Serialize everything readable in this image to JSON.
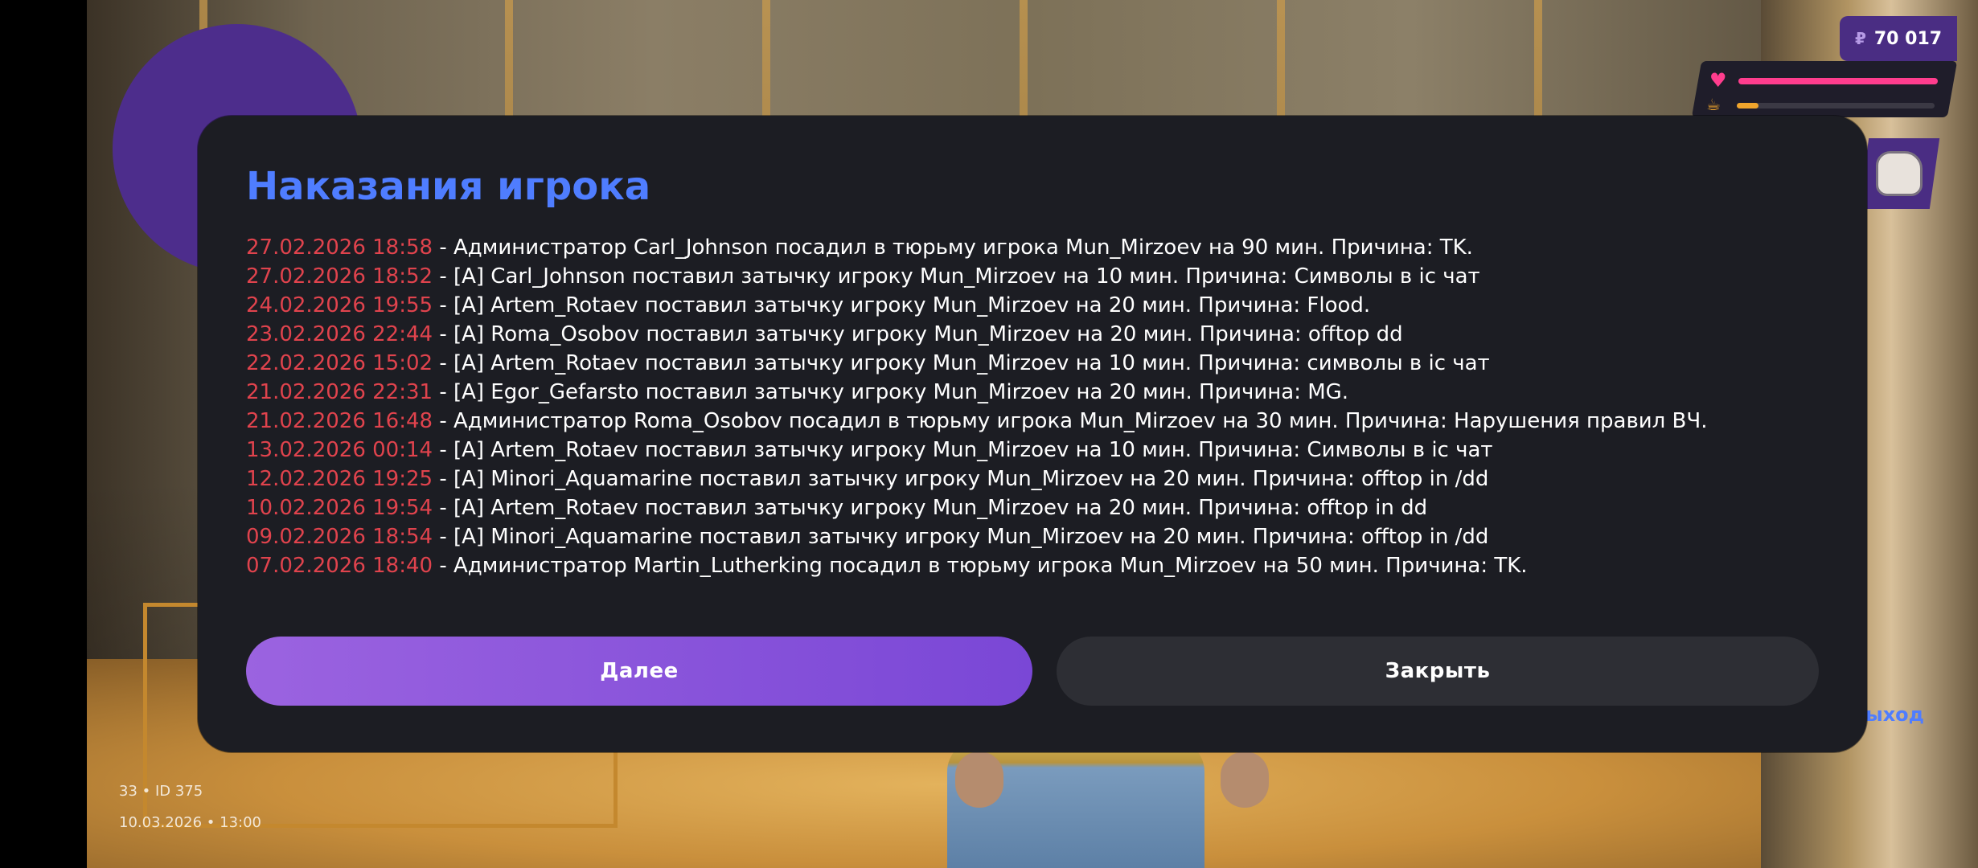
{
  "hud": {
    "money_currency": "₽",
    "money": "70 017",
    "health_fraction": 1.0,
    "hunger_fraction": 0.11,
    "exit_label": "ыход",
    "player_id_line": "33 • ID 375",
    "datetime_line": "10.03.2026 • 13:00"
  },
  "dialog": {
    "title": "Наказания игрока",
    "entries": [
      {
        "date": "27.02.2026 18:58",
        "text": " - Администратор Carl_Johnson посадил в тюрьму игрока Mun_Mirzoev на 90 мин. Причина: TK."
      },
      {
        "date": "27.02.2026 18:52",
        "text": " - [A] Carl_Johnson поставил затычку игроку Mun_Mirzoev на 10 мин. Причина: Символы в ic чат"
      },
      {
        "date": "24.02.2026 19:55",
        "text": " - [A] Artem_Rotaev поставил затычку игроку Mun_Mirzoev на 20 мин. Причина: Flood."
      },
      {
        "date": "23.02.2026 22:44",
        "text": " - [A] Roma_Osobov поставил затычку игроку Mun_Mirzoev на 20 мин. Причина: offtop dd"
      },
      {
        "date": "22.02.2026 15:02",
        "text": " - [A] Artem_Rotaev поставил затычку игроку Mun_Mirzoev на 10 мин. Причина: символы в ic чат"
      },
      {
        "date": "21.02.2026 22:31",
        "text": " - [A] Egor_Gefarsto поставил затычку игроку Mun_Mirzoev на 20 мин. Причина: MG."
      },
      {
        "date": "21.02.2026 16:48",
        "text": " - Администратор Roma_Osobov посадил в тюрьму игрока Mun_Mirzoev на 30 мин. Причина: Нарушения правил ВЧ."
      },
      {
        "date": "13.02.2026 00:14",
        "text": " - [A] Artem_Rotaev поставил затычку игроку Mun_Mirzoev на 10 мин. Причина: Символы в ic чат"
      },
      {
        "date": "12.02.2026 19:25",
        "text": " - [A] Minori_Aquamarine поставил затычку игроку Mun_Mirzoev на 20 мин. Причина: offtop in /dd"
      },
      {
        "date": "10.02.2026 19:54",
        "text": " - [A] Artem_Rotaev поставил затычку игроку Mun_Mirzoev на 20 мин. Причина: offtop in dd"
      },
      {
        "date": "09.02.2026 18:54",
        "text": " - [A] Minori_Aquamarine поставил затычку игроку Mun_Mirzoev на 20 мин. Причина: offtop in /dd"
      },
      {
        "date": "07.02.2026 18:40",
        "text": " - Администратор Martin_Lutherking посадил в тюрьму игрока Mun_Mirzoev на 50 мин. Причина: TK."
      }
    ],
    "next_label": "Далее",
    "close_label": "Закрыть"
  },
  "colors": {
    "title": "#4f7dff",
    "date": "#e0434d",
    "dialog_bg": "#1c1d23",
    "next_button": "#8a55dc",
    "close_button": "#2d2e34",
    "hud_purple": "#4a2d83",
    "health": "#ff3d8e",
    "hunger": "#f0a52c"
  },
  "icons": {
    "currency": "ruble-icon",
    "health": "heart-icon",
    "hunger": "cup-icon",
    "weapon": "fist-icon"
  }
}
